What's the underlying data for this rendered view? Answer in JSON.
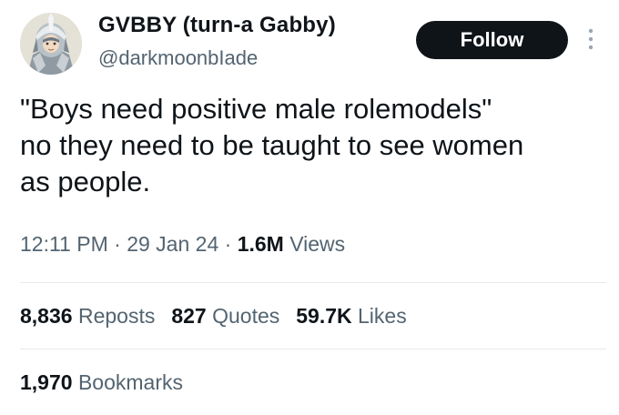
{
  "author": {
    "display_name": "GVBBY (turn-a Gabby)",
    "handle": "@darkmoonbIade",
    "avatar_icon": "armored-character-avatar"
  },
  "follow_button": {
    "label": "Follow"
  },
  "more_menu": {
    "icon": "more-vertical-icon"
  },
  "tweet": {
    "text": "\"Boys need positive male rolemodels\"\nno they need to be taught to see women\nas people.",
    "time": "12:11 PM",
    "separator": "·",
    "date": "29 Jan 24",
    "views_count": "1.6M",
    "views_label": "Views"
  },
  "stats": {
    "reposts_count": "8,836",
    "reposts_label": "Reposts",
    "quotes_count": "827",
    "quotes_label": "Quotes",
    "likes_count": "59.7K",
    "likes_label": "Likes",
    "bookmarks_count": "1,970",
    "bookmarks_label": "Bookmarks"
  },
  "colors": {
    "text_primary": "#0f1419",
    "text_secondary": "#536471",
    "button_bg": "#0f1419",
    "divider": "#e7e9ea"
  }
}
